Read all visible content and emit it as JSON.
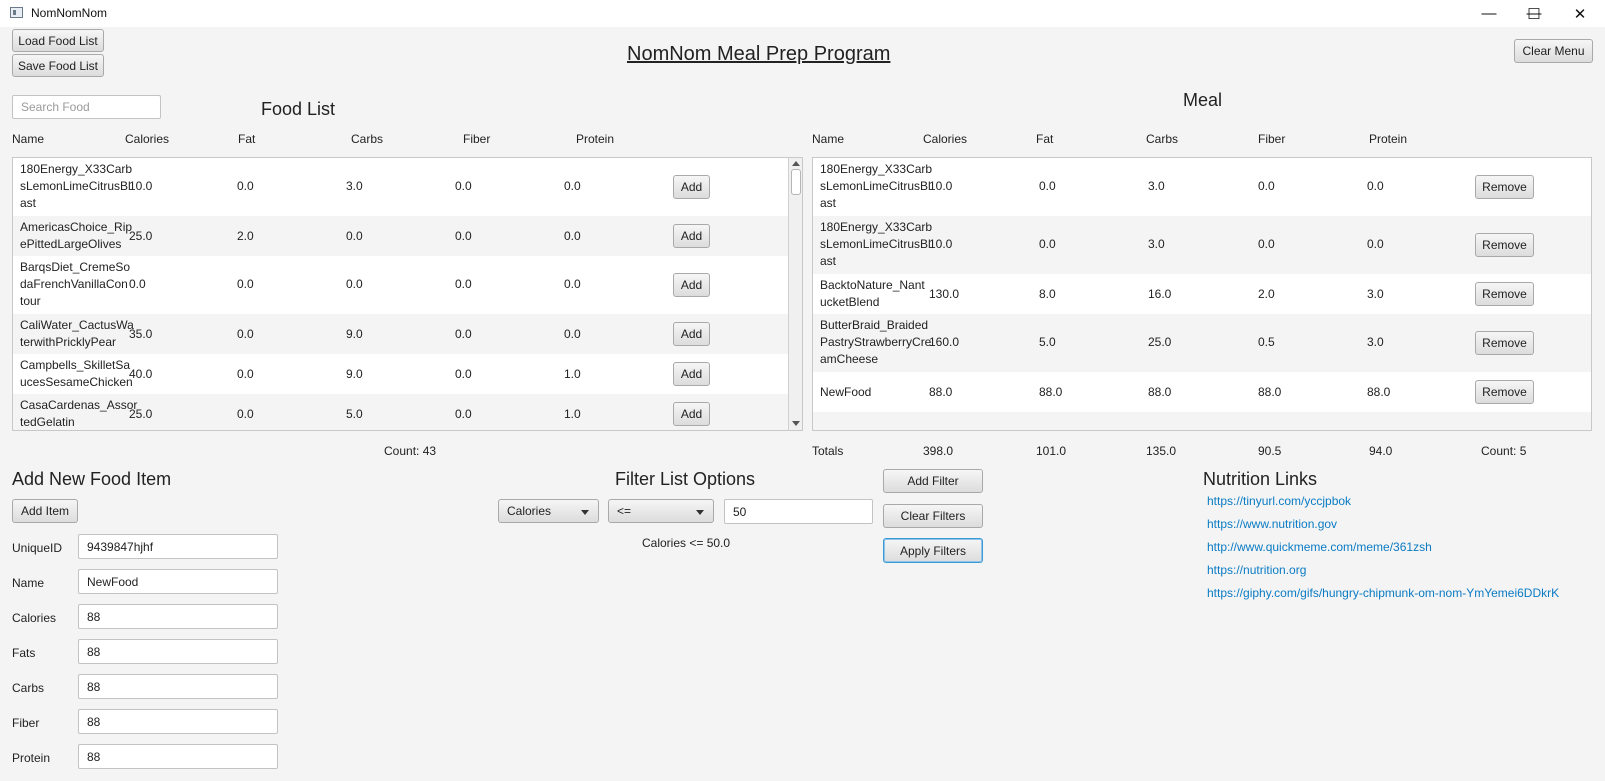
{
  "window": {
    "title": "NomNomNom",
    "controls": [
      "—",
      "☐",
      "✕"
    ]
  },
  "header": {
    "title": "NomNom Meal Prep Program",
    "load_label": "Load Food List",
    "save_label": "Save Food List",
    "clear_menu_label": "Clear Menu"
  },
  "food_list": {
    "heading": "Food List",
    "search_placeholder": "Search Food",
    "columns": [
      "Name",
      "Calories",
      "Fat",
      "Carbs",
      "Fiber",
      "Protein"
    ],
    "add_label": "Add",
    "rows": [
      {
        "name": "180Energy_X33Carb\nsLemonLimeCitrusBl\nast",
        "calories": "10.0",
        "fat": "0.0",
        "carbs": "3.0",
        "fiber": "0.0",
        "protein": "0.0"
      },
      {
        "name": "AmericasChoice_Rip\nePittedLargeOlives",
        "calories": "25.0",
        "fat": "2.0",
        "carbs": "0.0",
        "fiber": "0.0",
        "protein": "0.0"
      },
      {
        "name": "BarqsDiet_CremeSo\ndaFrenchVanillaCon\ntour",
        "calories": "0.0",
        "fat": "0.0",
        "carbs": "0.0",
        "fiber": "0.0",
        "protein": "0.0"
      },
      {
        "name": "CaliWater_CactusWa\nterwithPricklyPear",
        "calories": "35.0",
        "fat": "0.0",
        "carbs": "9.0",
        "fiber": "0.0",
        "protein": "0.0"
      },
      {
        "name": "Campbells_SkilletSa\nucesSesameChicken",
        "calories": "40.0",
        "fat": "0.0",
        "carbs": "9.0",
        "fiber": "0.0",
        "protein": "1.0"
      },
      {
        "name": "CasaCardenas_Assor\ntedGelatin",
        "calories": "25.0",
        "fat": "0.0",
        "carbs": "5.0",
        "fiber": "0.0",
        "protein": "1.0"
      }
    ],
    "count_label": "Count: 43"
  },
  "meal": {
    "heading": "Meal",
    "columns": [
      "Name",
      "Calories",
      "Fat",
      "Carbs",
      "Fiber",
      "Protein"
    ],
    "remove_label": "Remove",
    "rows": [
      {
        "name": "180Energy_X33Carb\nsLemonLimeCitrusBl\nast",
        "calories": "10.0",
        "fat": "0.0",
        "carbs": "3.0",
        "fiber": "0.0",
        "protein": "0.0"
      },
      {
        "name": "180Energy_X33Carb\nsLemonLimeCitrusBl\nast",
        "calories": "10.0",
        "fat": "0.0",
        "carbs": "3.0",
        "fiber": "0.0",
        "protein": "0.0"
      },
      {
        "name": "BacktoNature_Nant\nucketBlend",
        "calories": "130.0",
        "fat": "8.0",
        "carbs": "16.0",
        "fiber": "2.0",
        "protein": "3.0"
      },
      {
        "name": "ButterBraid_Braided\nPastryStrawberryCre\namCheese",
        "calories": "160.0",
        "fat": "5.0",
        "carbs": "25.0",
        "fiber": "0.5",
        "protein": "3.0"
      },
      {
        "name": "NewFood",
        "calories": "88.0",
        "fat": "88.0",
        "carbs": "88.0",
        "fiber": "88.0",
        "protein": "88.0"
      }
    ],
    "totals": {
      "label": "Totals",
      "calories": "398.0",
      "fat": "101.0",
      "carbs": "135.0",
      "fiber": "90.5",
      "protein": "94.0",
      "count": "Count: 5"
    }
  },
  "add_item": {
    "heading": "Add New Food Item",
    "button_label": "Add Item",
    "fields": [
      {
        "label": "UniqueID",
        "value": "9439847hjhf"
      },
      {
        "label": "Name",
        "value": "NewFood"
      },
      {
        "label": "Calories",
        "value": "88"
      },
      {
        "label": "Fats",
        "value": "88"
      },
      {
        "label": "Carbs",
        "value": "88"
      },
      {
        "label": "Fiber",
        "value": "88"
      },
      {
        "label": "Protein",
        "value": "88"
      }
    ]
  },
  "filter": {
    "heading": "Filter List Options",
    "field_value": "Calories",
    "operator_value": "<=",
    "amount_value": "50",
    "add_filter_label": "Add Filter",
    "clear_filters_label": "Clear Filters",
    "apply_filters_label": "Apply Filters",
    "active_filter": "Calories <= 50.0"
  },
  "links": {
    "heading": "Nutrition Links",
    "items": [
      "https://tinyurl.com/yccjpbok",
      "https://www.nutrition.gov",
      "http://www.quickmeme.com/meme/361zsh",
      "https://nutrition.org",
      "https://giphy.com/gifs/hungry-chipmunk-om-nom-YmYemei6DDkrK"
    ]
  }
}
